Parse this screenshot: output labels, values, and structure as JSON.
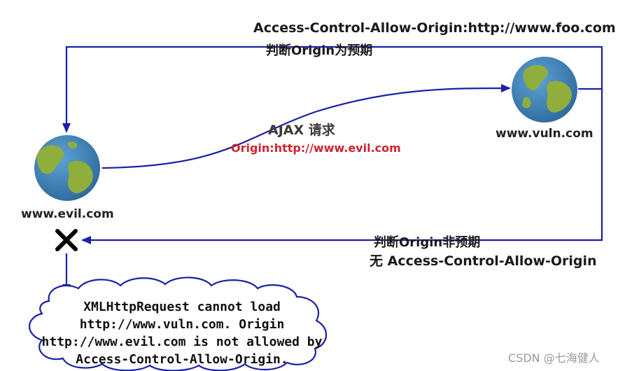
{
  "labels": {
    "top_header": "Access-Control-Allow-Origin:http://www.foo.com",
    "top_judge": "判断Origin为预期",
    "ajax": "AJAX 请求",
    "origin_evil": "Origin:http://www.evil.com",
    "vuln_host": "www.vuln.com",
    "evil_host": "www.evil.com",
    "bottom_judge": "判断Origin非预期",
    "bottom_no": "无 Access-Control-Allow-Origin"
  },
  "error_cloud": {
    "lines": [
      "XMLHttpRequest cannot load",
      "http://www.vuln.com. Origin",
      "http://www.evil.com is not allowed by",
      "Access-Control-Allow-Origin."
    ]
  },
  "watermark": "CSDN @七海健人",
  "colors": {
    "arrow": "#1c1fa8",
    "ocean": "#3b7fb5",
    "land": "#8fae3c",
    "origin_text": "#d0232f",
    "cross": "#000000"
  },
  "icons": [
    "globe-icon",
    "globe-icon",
    "cross-icon",
    "cloud-shape"
  ]
}
